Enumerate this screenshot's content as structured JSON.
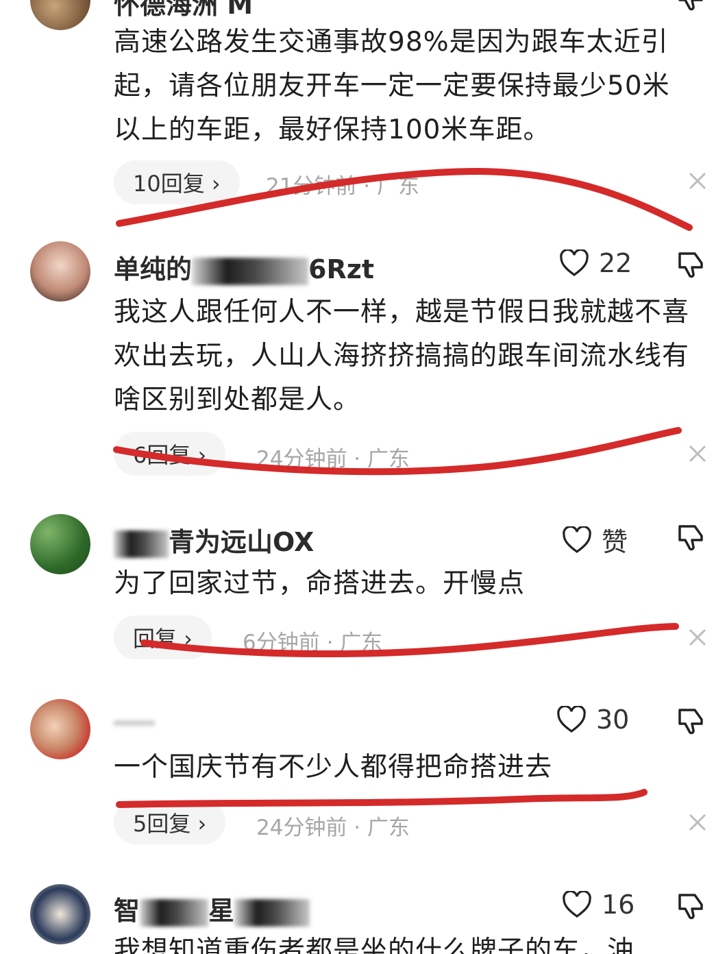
{
  "comments": [
    {
      "name_visible": "怀德海洲 M",
      "text": "高速公路发生交通事故98%是因为跟车太近引起，请各位朋友开车一定一定要保持最少50米以上的车距，最好保持100米车距。",
      "reply_label": "10回复 ›",
      "meta": "21分钟前 · 广东",
      "avatar_color": "#8a6a4a"
    },
    {
      "name_visible": "单纯的",
      "name_tail": "6Rzt",
      "likes": "22",
      "text": "我这人跟任何人不一样，越是节假日我就越不喜欢出去玩，人山人海挤挤搞搞的跟车间流水线有啥区别到处都是人。",
      "reply_label": "6回复 ›",
      "meta": "24分钟前 · 广东",
      "avatar_color": "#b07a6a"
    },
    {
      "name_visible": "青为远山OX",
      "likes": "赞",
      "text": "为了回家过节，命搭进去。开慢点",
      "reply_label": "回复 ›",
      "meta": "6分钟前 · 广东",
      "avatar_color": "#3f7d3a"
    },
    {
      "name_visible": "",
      "likes": "30",
      "text": "一个国庆节有不少人都得把命搭进去",
      "reply_label": "5回复 ›",
      "meta": "24分钟前 · 广东",
      "avatar_color": "#c84a3a"
    },
    {
      "name_visible": "智",
      "name_tail": "星",
      "likes": "16",
      "text": "我想知道重伤者都是坐的什么牌子的车，油",
      "avatar_color": "#2a3a5a"
    }
  ],
  "colors": {
    "annotation_red": "#d42a2a",
    "meta_gray": "#a6a6a6",
    "pill_bg": "#f4f4f4"
  },
  "icons": [
    "heart-icon",
    "thumb-down-icon",
    "close-icon",
    "chevron-right-icon"
  ]
}
